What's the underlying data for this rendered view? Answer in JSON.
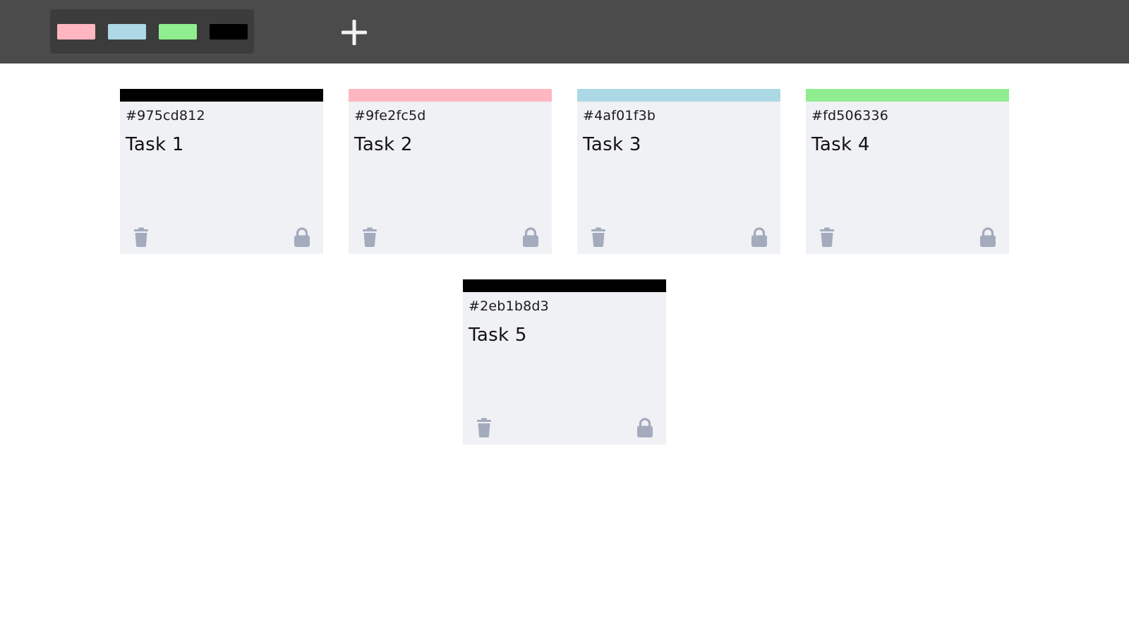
{
  "toolbar": {
    "palette": [
      {
        "name": "pink",
        "color": "#ffb6c1"
      },
      {
        "name": "blue",
        "color": "#add8e6"
      },
      {
        "name": "green",
        "color": "#90ee90"
      },
      {
        "name": "black",
        "color": "#000000"
      }
    ],
    "add_icon": "plus-icon"
  },
  "tickets": [
    {
      "id": "#975cd812",
      "title": "Task 1",
      "color": "#000000"
    },
    {
      "id": "#9fe2fc5d",
      "title": "Task 2",
      "color": "#ffb6c1"
    },
    {
      "id": "#4af01f3b",
      "title": "Task 3",
      "color": "#add8e6"
    },
    {
      "id": "#fd506336",
      "title": "Task 4",
      "color": "#90ee90"
    },
    {
      "id": "#2eb1b8d3",
      "title": "Task 5",
      "color": "#000000"
    }
  ],
  "icons": {
    "delete": "trash-icon",
    "lock": "lock-icon"
  },
  "colors": {
    "toolbar_bg": "#4b4b4b",
    "palette_bg": "#3c3c3c",
    "card_bg": "#f0f1f4",
    "icon_color": "#a3abbd"
  }
}
